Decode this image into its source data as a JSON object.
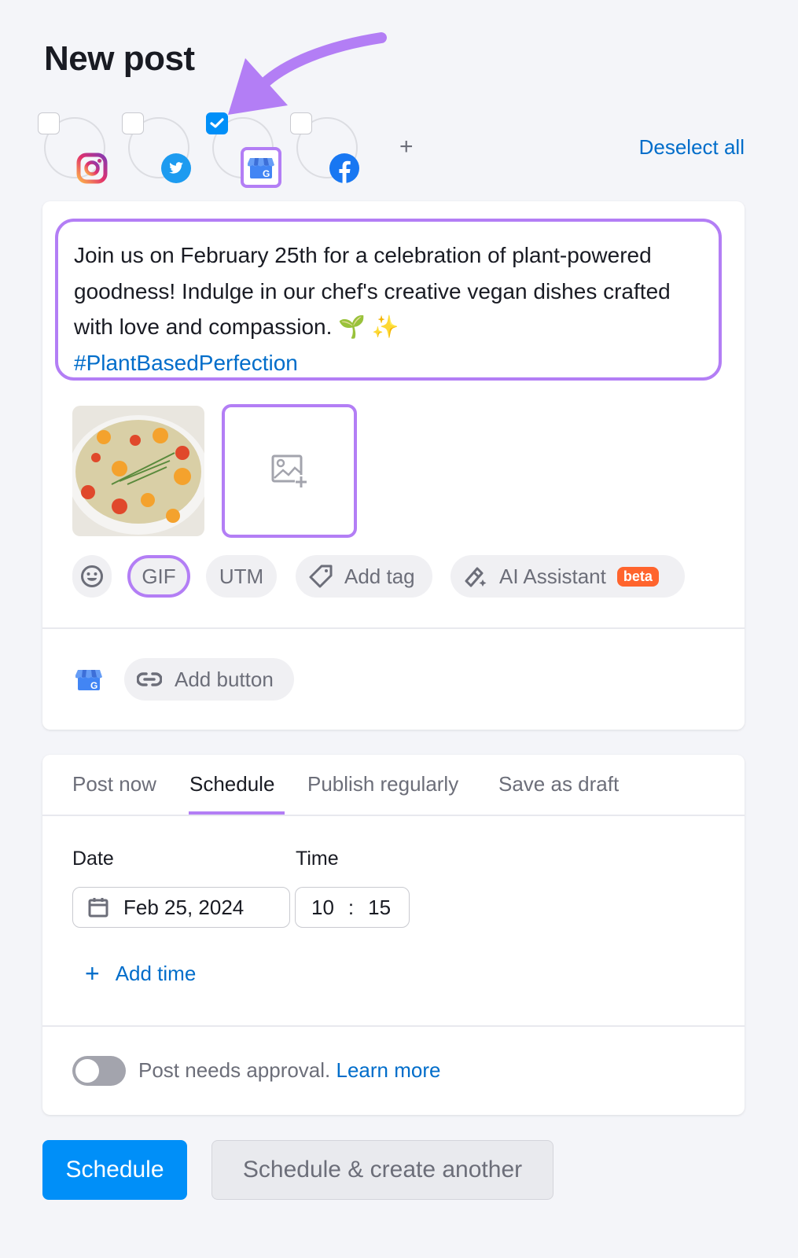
{
  "page": {
    "title": "New post"
  },
  "channels": [
    {
      "name": "Instagram",
      "icon": "instagram-icon",
      "selected": false
    },
    {
      "name": "Twitter",
      "icon": "twitter-icon",
      "selected": false
    },
    {
      "name": "Google Business Profile",
      "icon": "google-business-icon",
      "selected": true
    },
    {
      "name": "Facebook",
      "icon": "facebook-icon",
      "selected": false
    }
  ],
  "channel_actions": {
    "add_label": "+",
    "deselect_all": "Deselect all"
  },
  "composer": {
    "text": "Join us on February 25th for a celebration of plant-powered goodness! Indulge in our chef's creative vegan dishes crafted with love and compassion. 🌱 ✨",
    "hashtag": "#PlantBasedPerfection",
    "media": [
      {
        "type": "image",
        "description": "quinoa with roasted vegetables"
      }
    ],
    "toolbar": {
      "emoji_icon": "emoji-icon",
      "gif": "GIF",
      "utm": "UTM",
      "add_tag": "Add tag",
      "ai_assistant": "AI Assistant",
      "ai_badge": "beta"
    },
    "gbp_add_button": "Add button"
  },
  "publish": {
    "tabs": [
      {
        "label": "Post now",
        "active": false
      },
      {
        "label": "Schedule",
        "active": true
      },
      {
        "label": "Publish regularly",
        "active": false
      },
      {
        "label": "Save as draft",
        "active": false
      }
    ],
    "date_label": "Date",
    "time_label": "Time",
    "date_value": "Feb 25, 2024",
    "time_hour": "10",
    "time_sep": ":",
    "time_minute": "15",
    "add_time": "Add time",
    "approval_toggle_on": false,
    "approval_text": "Post needs approval.",
    "learn_more": "Learn more"
  },
  "footer": {
    "primary": "Schedule",
    "secondary": "Schedule & create another"
  },
  "colors": {
    "accent": "#008ff8",
    "highlight": "#b37ef5",
    "link": "#006dca",
    "beta": "#ff642d"
  }
}
